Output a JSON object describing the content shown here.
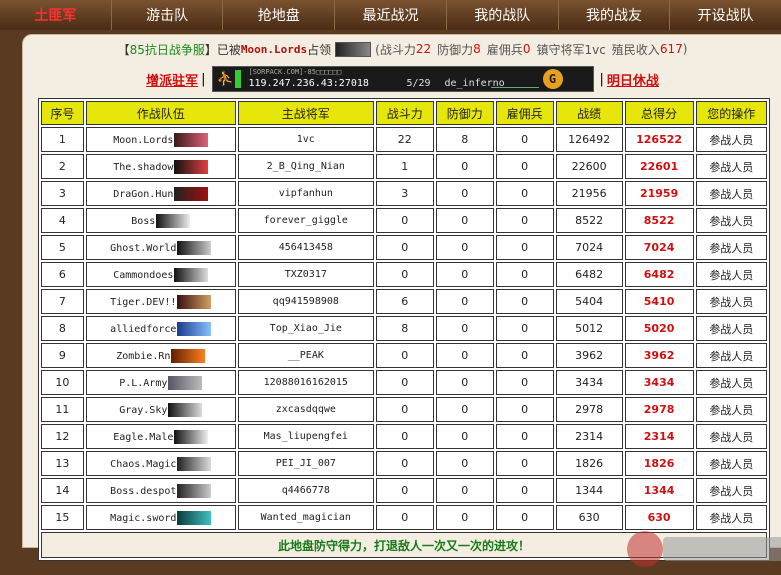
{
  "nav": {
    "items": [
      {
        "label": "土匪军",
        "active": true
      },
      {
        "label": "游击队",
        "active": false
      },
      {
        "label": "抢地盘",
        "active": false
      },
      {
        "label": "最近战况",
        "active": false
      },
      {
        "label": "我的战队",
        "active": false
      },
      {
        "label": "我的战友",
        "active": false
      },
      {
        "label": "开设战队",
        "active": false
      }
    ]
  },
  "info": {
    "open_bracket": "【",
    "event": "85抗日战争服",
    "close_bracket": "】",
    "captured_by": "已被",
    "team": "Moon.Lords",
    "occupied": "占领",
    "power_label": "(战斗力",
    "power_value": "22",
    "defense_label": "防御力",
    "defense_value": "8",
    "merc_label": "雇佣兵",
    "merc_value": "0",
    "general_text": "镇守将军1vc",
    "income_label": "殖民收入",
    "income_value": "617",
    "close_paren": ")"
  },
  "toolbar": {
    "left_link": "增派驻军",
    "right_link": "明日休战",
    "sep": "|",
    "server_tag": "[SORPACK.COM]-85□□□□□□",
    "server_ip": "119.247.236.43:27018",
    "players": "5/29",
    "map": "de_inferno",
    "gt_icon": "G"
  },
  "table": {
    "headers": [
      "序号",
      "作战队伍",
      "主战将军",
      "战斗力",
      "防御力",
      "雇佣兵",
      "战绩",
      "总得分",
      "您的操作"
    ],
    "rows": [
      {
        "no": "1",
        "team": "Moon.Lords",
        "general": "1vc",
        "power": "22",
        "defense": "8",
        "merc": "0",
        "record": "126492",
        "total": "126522",
        "action": "参战人员"
      },
      {
        "no": "2",
        "team": "The.shadow",
        "general": "2_B_Qing_Nian",
        "power": "1",
        "defense": "0",
        "merc": "0",
        "record": "22600",
        "total": "22601",
        "action": "参战人员"
      },
      {
        "no": "3",
        "team": "DraGon.Hun",
        "general": "vipfanhun",
        "power": "3",
        "defense": "0",
        "merc": "0",
        "record": "21956",
        "total": "21959",
        "action": "参战人员"
      },
      {
        "no": "4",
        "team": "Boss",
        "general": "forever_giggle",
        "power": "0",
        "defense": "0",
        "merc": "0",
        "record": "8522",
        "total": "8522",
        "action": "参战人员"
      },
      {
        "no": "5",
        "team": "Ghost.World",
        "general": "456413458",
        "power": "0",
        "defense": "0",
        "merc": "0",
        "record": "7024",
        "total": "7024",
        "action": "参战人员"
      },
      {
        "no": "6",
        "team": "Cammondoes",
        "general": "TXZ0317",
        "power": "0",
        "defense": "0",
        "merc": "0",
        "record": "6482",
        "total": "6482",
        "action": "参战人员"
      },
      {
        "no": "7",
        "team": "Tiger.DEV!!",
        "general": "qq941598908",
        "power": "6",
        "defense": "0",
        "merc": "0",
        "record": "5404",
        "total": "5410",
        "action": "参战人员"
      },
      {
        "no": "8",
        "team": "alliedforce",
        "general": "Top_Xiao_Jie",
        "power": "8",
        "defense": "0",
        "merc": "0",
        "record": "5012",
        "total": "5020",
        "action": "参战人员"
      },
      {
        "no": "9",
        "team": "Zombie.Rn",
        "general": "__PEAK",
        "power": "0",
        "defense": "0",
        "merc": "0",
        "record": "3962",
        "total": "3962",
        "action": "参战人员"
      },
      {
        "no": "10",
        "team": "P.L.Army",
        "general": "12088016162015",
        "power": "0",
        "defense": "0",
        "merc": "0",
        "record": "3434",
        "total": "3434",
        "action": "参战人员"
      },
      {
        "no": "11",
        "team": "Gray.Sky",
        "general": "zxcasdqqwe",
        "power": "0",
        "defense": "0",
        "merc": "0",
        "record": "2978",
        "total": "2978",
        "action": "参战人员"
      },
      {
        "no": "12",
        "team": "Eagle.Male",
        "general": "Mas_liupengfei",
        "power": "0",
        "defense": "0",
        "merc": "0",
        "record": "2314",
        "total": "2314",
        "action": "参战人员"
      },
      {
        "no": "13",
        "team": "Chaos.Magic",
        "general": "PEI_JI_007",
        "power": "0",
        "defense": "0",
        "merc": "0",
        "record": "1826",
        "total": "1826",
        "action": "参战人员"
      },
      {
        "no": "14",
        "team": "Boss.despot",
        "general": "q4466778",
        "power": "0",
        "defense": "0",
        "merc": "0",
        "record": "1344",
        "total": "1344",
        "action": "参战人员"
      },
      {
        "no": "15",
        "team": "Magic.sword",
        "general": "Wanted_magician",
        "power": "0",
        "defense": "0",
        "merc": "0",
        "record": "630",
        "total": "630",
        "action": "参战人员"
      }
    ],
    "footer": "此地盘防守得力，打退敌人一次又一次的进攻！"
  },
  "colors": {
    "header_bg": "#e6e60a",
    "score_red": "#d01010",
    "footer_green": "#1a7a1a",
    "nav_active": "#ff3030"
  }
}
